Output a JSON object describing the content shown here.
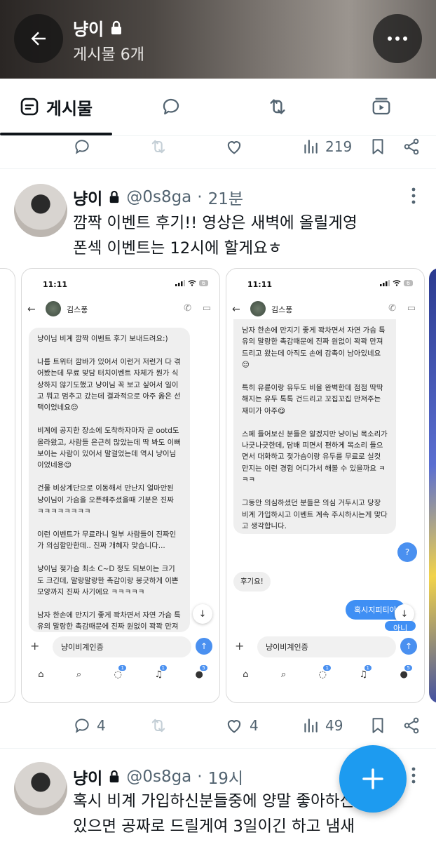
{
  "header": {
    "name": "냥이",
    "subtitle": "게시물 6개"
  },
  "tabs": {
    "posts_label": "게시물"
  },
  "prev_tweet": {
    "views": "219"
  },
  "tweet1": {
    "name": "냥이",
    "handle": "@0s8ga",
    "dot": "·",
    "time": "21분",
    "text": "깜짝 이벤트 후기!! 영상은 새벽에 올릴게영\n폰섹 이벤트는 12시에 할게요ㅎ",
    "replies": "4",
    "likes": "4",
    "views": "49"
  },
  "chat_shot_1": {
    "time": "11:11",
    "battery": "6",
    "contact": "김스퐁",
    "message": "냥이님 비계 깜짝 이벤트 후기 보내드려요:)\n\n나름 트위터 깜바가 있어서 이런거 저런거 다 겪어봤는데 무료 맞담 터치이벤트 자체가 뭔가 식상하지 않기도했고 냥이님 꼭 보고 싶어서 일이고 뭐고 멈추고 갔는데 결과적으로 아주 옳은 선택이었네요😌\n\n비계에 공지한 장소에 도착하자마자 곧 ootd도 올라왔고, 사람들 은근히 많았는데 딱 봐도 이뻐보이는 사람이 있어서 말걸었는데 역시 냥이님이었네용😊\n\n건물 비상계단으로 이동해서 만난지 얼마안된 냥이님이 가슴을 오픈해주셨을때 기분은 진짜 ㅋㅋㅋㅋㅋㅋㅋㅋ\n\n이런 이벤트가 무료라니 일부 사람들이 진짜인가 의심할만한데.. 진짜 개혜자 맞습니다...\n\n냥이님 젖가슴 최소 C~D 정도 되보이는 크기도 크긴데, 말랑말랑한 촉감이랑 봉긋하게 이쁜 모양까지 진짜 사기에요 ㅋㅋㅋㅋㅋ\n\n남자 한손에 만지기 좋게 꽉차면서 자연 가슴 특유의 말랑한 촉감때문에 진짜 원없이 꽉꽉 만져드리고 왔는데 아직도 손에 감촉이 남아있네요😊",
    "input": "냥이비계인증"
  },
  "chat_shot_2": {
    "time": "11:11",
    "battery": "6",
    "contact": "김스퐁",
    "message": "남자 한손에 만지기 좋게 꽉차면서 자연 가슴 특유의 말랑한 촉감때문에 진짜 원없이 꽉꽉 만져드리고 왔는데 아직도 손에 감촉이 남아있네요😌\n\n특히 유륜이랑 유두도 비율 완벽한데 점점 딱딱해지는 유두 톡톡 건드리고 꼬집꼬집 만져주는 재미가 아주😋\n\n스페 들어보신 분들은 알겠지만 냥이님 목소리가 나긋나긋한데, 담배 피면서 편하게 목소리 들으면서 대화하고 젖가슴이랑 유두를 무료로 실컷 만지는 이런 경험 어디가서 해볼 수 있을까요 ㅋㅋㅋ\n\n그동안 의심하셨던 분들은 의심 거두시고 당장 비계 가입하시고 이벤트 계속 주시하시는게 맞다고 생각합니다.\n\n혜자 goat 이벤트인거 제가 인증합니다.",
    "question": "?",
    "reply": "후기요!",
    "blue1": "혹시지피티야",
    "blue2": "아니",
    "input": "냥이비계인증"
  },
  "tweet2": {
    "name": "냥이",
    "handle": "@0s8ga",
    "dot": "·",
    "time": "19시",
    "text": "혹시 비계 가입하신분들중에 양말 좋아하신 분들\n있으면 공짜로 드릴게여 3일이긴 하고 냄새"
  },
  "colors": {
    "accent": "#1d9bf0",
    "text": "#0f1419",
    "muted": "#536471"
  },
  "icons": [
    "back-arrow-icon",
    "lock-icon",
    "more-icon",
    "posts-icon",
    "reply-icon",
    "repost-icon",
    "media-icon",
    "like-icon",
    "views-icon",
    "bookmark-icon",
    "share-icon",
    "compose-plus-icon"
  ]
}
